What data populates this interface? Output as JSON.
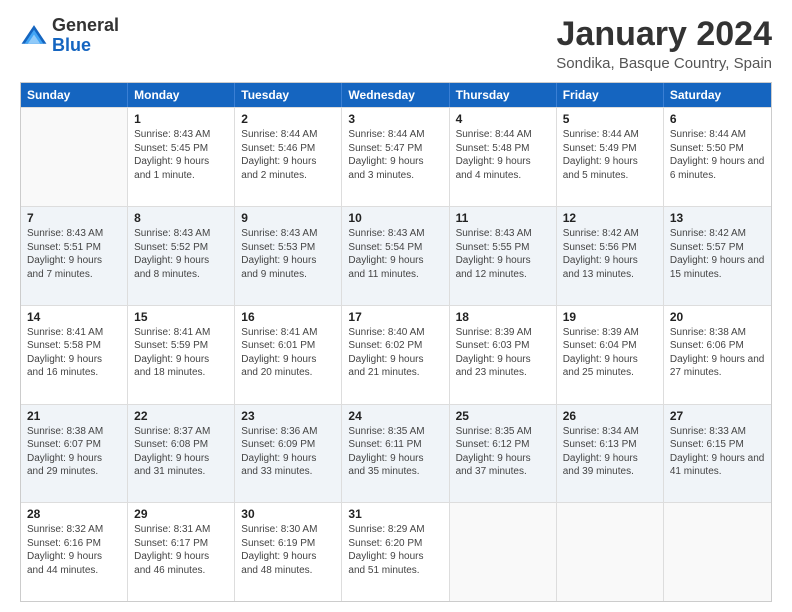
{
  "logo": {
    "general": "General",
    "blue": "Blue"
  },
  "header": {
    "month": "January 2024",
    "location": "Sondika, Basque Country, Spain"
  },
  "weekdays": [
    "Sunday",
    "Monday",
    "Tuesday",
    "Wednesday",
    "Thursday",
    "Friday",
    "Saturday"
  ],
  "rows": [
    [
      {
        "day": "",
        "sunrise": "",
        "sunset": "",
        "daylight": "",
        "empty": true
      },
      {
        "day": "1",
        "sunrise": "Sunrise: 8:43 AM",
        "sunset": "Sunset: 5:45 PM",
        "daylight": "Daylight: 9 hours and 1 minute."
      },
      {
        "day": "2",
        "sunrise": "Sunrise: 8:44 AM",
        "sunset": "Sunset: 5:46 PM",
        "daylight": "Daylight: 9 hours and 2 minutes."
      },
      {
        "day": "3",
        "sunrise": "Sunrise: 8:44 AM",
        "sunset": "Sunset: 5:47 PM",
        "daylight": "Daylight: 9 hours and 3 minutes."
      },
      {
        "day": "4",
        "sunrise": "Sunrise: 8:44 AM",
        "sunset": "Sunset: 5:48 PM",
        "daylight": "Daylight: 9 hours and 4 minutes."
      },
      {
        "day": "5",
        "sunrise": "Sunrise: 8:44 AM",
        "sunset": "Sunset: 5:49 PM",
        "daylight": "Daylight: 9 hours and 5 minutes."
      },
      {
        "day": "6",
        "sunrise": "Sunrise: 8:44 AM",
        "sunset": "Sunset: 5:50 PM",
        "daylight": "Daylight: 9 hours and 6 minutes."
      }
    ],
    [
      {
        "day": "7",
        "sunrise": "Sunrise: 8:43 AM",
        "sunset": "Sunset: 5:51 PM",
        "daylight": "Daylight: 9 hours and 7 minutes."
      },
      {
        "day": "8",
        "sunrise": "Sunrise: 8:43 AM",
        "sunset": "Sunset: 5:52 PM",
        "daylight": "Daylight: 9 hours and 8 minutes."
      },
      {
        "day": "9",
        "sunrise": "Sunrise: 8:43 AM",
        "sunset": "Sunset: 5:53 PM",
        "daylight": "Daylight: 9 hours and 9 minutes."
      },
      {
        "day": "10",
        "sunrise": "Sunrise: 8:43 AM",
        "sunset": "Sunset: 5:54 PM",
        "daylight": "Daylight: 9 hours and 11 minutes."
      },
      {
        "day": "11",
        "sunrise": "Sunrise: 8:43 AM",
        "sunset": "Sunset: 5:55 PM",
        "daylight": "Daylight: 9 hours and 12 minutes."
      },
      {
        "day": "12",
        "sunrise": "Sunrise: 8:42 AM",
        "sunset": "Sunset: 5:56 PM",
        "daylight": "Daylight: 9 hours and 13 minutes."
      },
      {
        "day": "13",
        "sunrise": "Sunrise: 8:42 AM",
        "sunset": "Sunset: 5:57 PM",
        "daylight": "Daylight: 9 hours and 15 minutes."
      }
    ],
    [
      {
        "day": "14",
        "sunrise": "Sunrise: 8:41 AM",
        "sunset": "Sunset: 5:58 PM",
        "daylight": "Daylight: 9 hours and 16 minutes."
      },
      {
        "day": "15",
        "sunrise": "Sunrise: 8:41 AM",
        "sunset": "Sunset: 5:59 PM",
        "daylight": "Daylight: 9 hours and 18 minutes."
      },
      {
        "day": "16",
        "sunrise": "Sunrise: 8:41 AM",
        "sunset": "Sunset: 6:01 PM",
        "daylight": "Daylight: 9 hours and 20 minutes."
      },
      {
        "day": "17",
        "sunrise": "Sunrise: 8:40 AM",
        "sunset": "Sunset: 6:02 PM",
        "daylight": "Daylight: 9 hours and 21 minutes."
      },
      {
        "day": "18",
        "sunrise": "Sunrise: 8:39 AM",
        "sunset": "Sunset: 6:03 PM",
        "daylight": "Daylight: 9 hours and 23 minutes."
      },
      {
        "day": "19",
        "sunrise": "Sunrise: 8:39 AM",
        "sunset": "Sunset: 6:04 PM",
        "daylight": "Daylight: 9 hours and 25 minutes."
      },
      {
        "day": "20",
        "sunrise": "Sunrise: 8:38 AM",
        "sunset": "Sunset: 6:06 PM",
        "daylight": "Daylight: 9 hours and 27 minutes."
      }
    ],
    [
      {
        "day": "21",
        "sunrise": "Sunrise: 8:38 AM",
        "sunset": "Sunset: 6:07 PM",
        "daylight": "Daylight: 9 hours and 29 minutes."
      },
      {
        "day": "22",
        "sunrise": "Sunrise: 8:37 AM",
        "sunset": "Sunset: 6:08 PM",
        "daylight": "Daylight: 9 hours and 31 minutes."
      },
      {
        "day": "23",
        "sunrise": "Sunrise: 8:36 AM",
        "sunset": "Sunset: 6:09 PM",
        "daylight": "Daylight: 9 hours and 33 minutes."
      },
      {
        "day": "24",
        "sunrise": "Sunrise: 8:35 AM",
        "sunset": "Sunset: 6:11 PM",
        "daylight": "Daylight: 9 hours and 35 minutes."
      },
      {
        "day": "25",
        "sunrise": "Sunrise: 8:35 AM",
        "sunset": "Sunset: 6:12 PM",
        "daylight": "Daylight: 9 hours and 37 minutes."
      },
      {
        "day": "26",
        "sunrise": "Sunrise: 8:34 AM",
        "sunset": "Sunset: 6:13 PM",
        "daylight": "Daylight: 9 hours and 39 minutes."
      },
      {
        "day": "27",
        "sunrise": "Sunrise: 8:33 AM",
        "sunset": "Sunset: 6:15 PM",
        "daylight": "Daylight: 9 hours and 41 minutes."
      }
    ],
    [
      {
        "day": "28",
        "sunrise": "Sunrise: 8:32 AM",
        "sunset": "Sunset: 6:16 PM",
        "daylight": "Daylight: 9 hours and 44 minutes."
      },
      {
        "day": "29",
        "sunrise": "Sunrise: 8:31 AM",
        "sunset": "Sunset: 6:17 PM",
        "daylight": "Daylight: 9 hours and 46 minutes."
      },
      {
        "day": "30",
        "sunrise": "Sunrise: 8:30 AM",
        "sunset": "Sunset: 6:19 PM",
        "daylight": "Daylight: 9 hours and 48 minutes."
      },
      {
        "day": "31",
        "sunrise": "Sunrise: 8:29 AM",
        "sunset": "Sunset: 6:20 PM",
        "daylight": "Daylight: 9 hours and 51 minutes."
      },
      {
        "day": "",
        "sunrise": "",
        "sunset": "",
        "daylight": "",
        "empty": true
      },
      {
        "day": "",
        "sunrise": "",
        "sunset": "",
        "daylight": "",
        "empty": true
      },
      {
        "day": "",
        "sunrise": "",
        "sunset": "",
        "daylight": "",
        "empty": true
      }
    ]
  ]
}
